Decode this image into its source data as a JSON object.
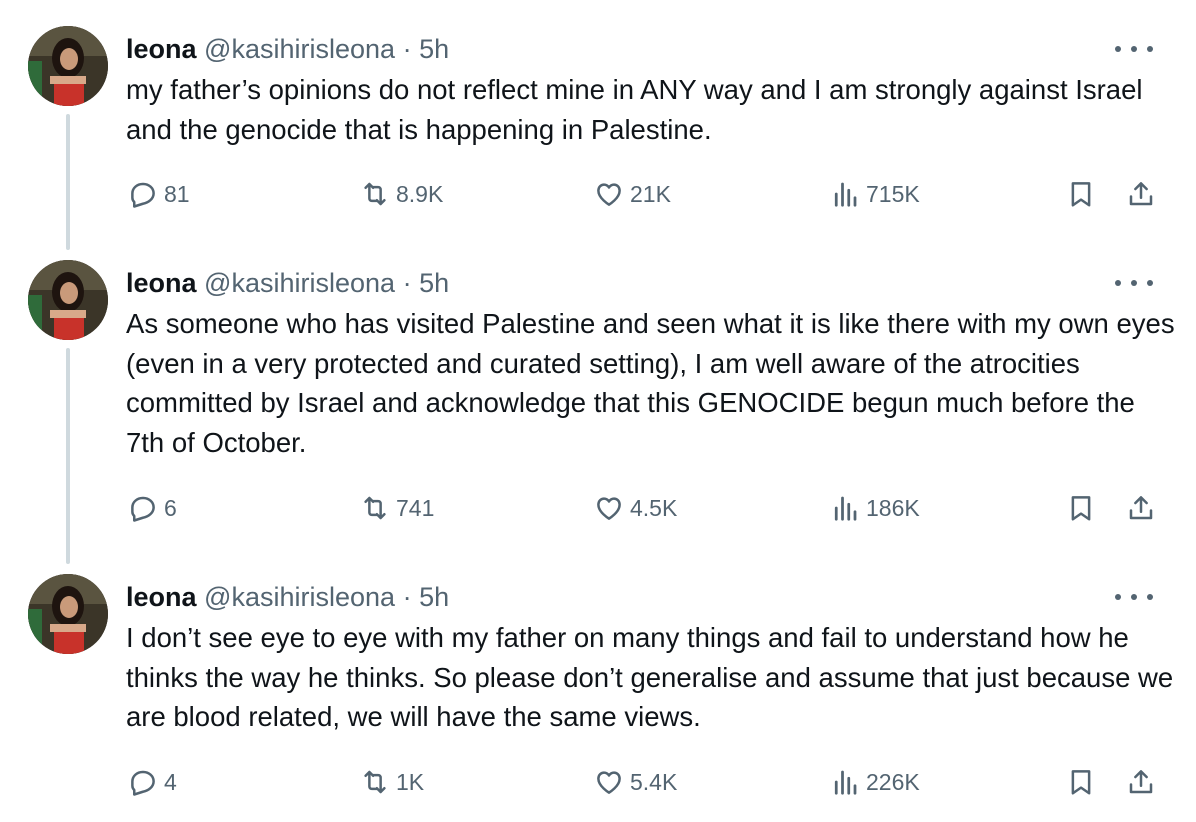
{
  "tweets": [
    {
      "name": "leona",
      "handle": "@kasihirisleona",
      "separator": "·",
      "time": "5h",
      "text": "my father’s opinions do not reflect mine in ANY way and I am strongly against Israel and the genocide that is happening in Palestine.",
      "replies": "81",
      "retweets": "8.9K",
      "likes": "21K",
      "views": "715K"
    },
    {
      "name": "leona",
      "handle": "@kasihirisleona",
      "separator": "·",
      "time": "5h",
      "text": "As someone who has visited Palestine and seen what it is like there with my own eyes (even in a very protected and curated setting), I am well aware of the atrocities committed by Israel and acknowledge that this GENOCIDE begun much before the 7th of October.",
      "replies": "6",
      "retweets": "741",
      "likes": "4.5K",
      "views": "186K"
    },
    {
      "name": "leona",
      "handle": "@kasihirisleona",
      "separator": "·",
      "time": "5h",
      "text": "I don’t see eye to eye with my father on many things and fail to understand how he thinks the way he thinks. So please don’t generalise and assume that just because we are blood related, we will have the same views.",
      "replies": "4",
      "retweets": "1K",
      "likes": "5.4K",
      "views": "226K"
    }
  ],
  "colors": {
    "text": "#0f1419",
    "secondary": "#536471",
    "thread_line": "#cfd9de"
  },
  "icons": [
    "reply-icon",
    "retweet-icon",
    "like-icon",
    "views-icon",
    "bookmark-icon",
    "share-icon",
    "more-icon"
  ]
}
